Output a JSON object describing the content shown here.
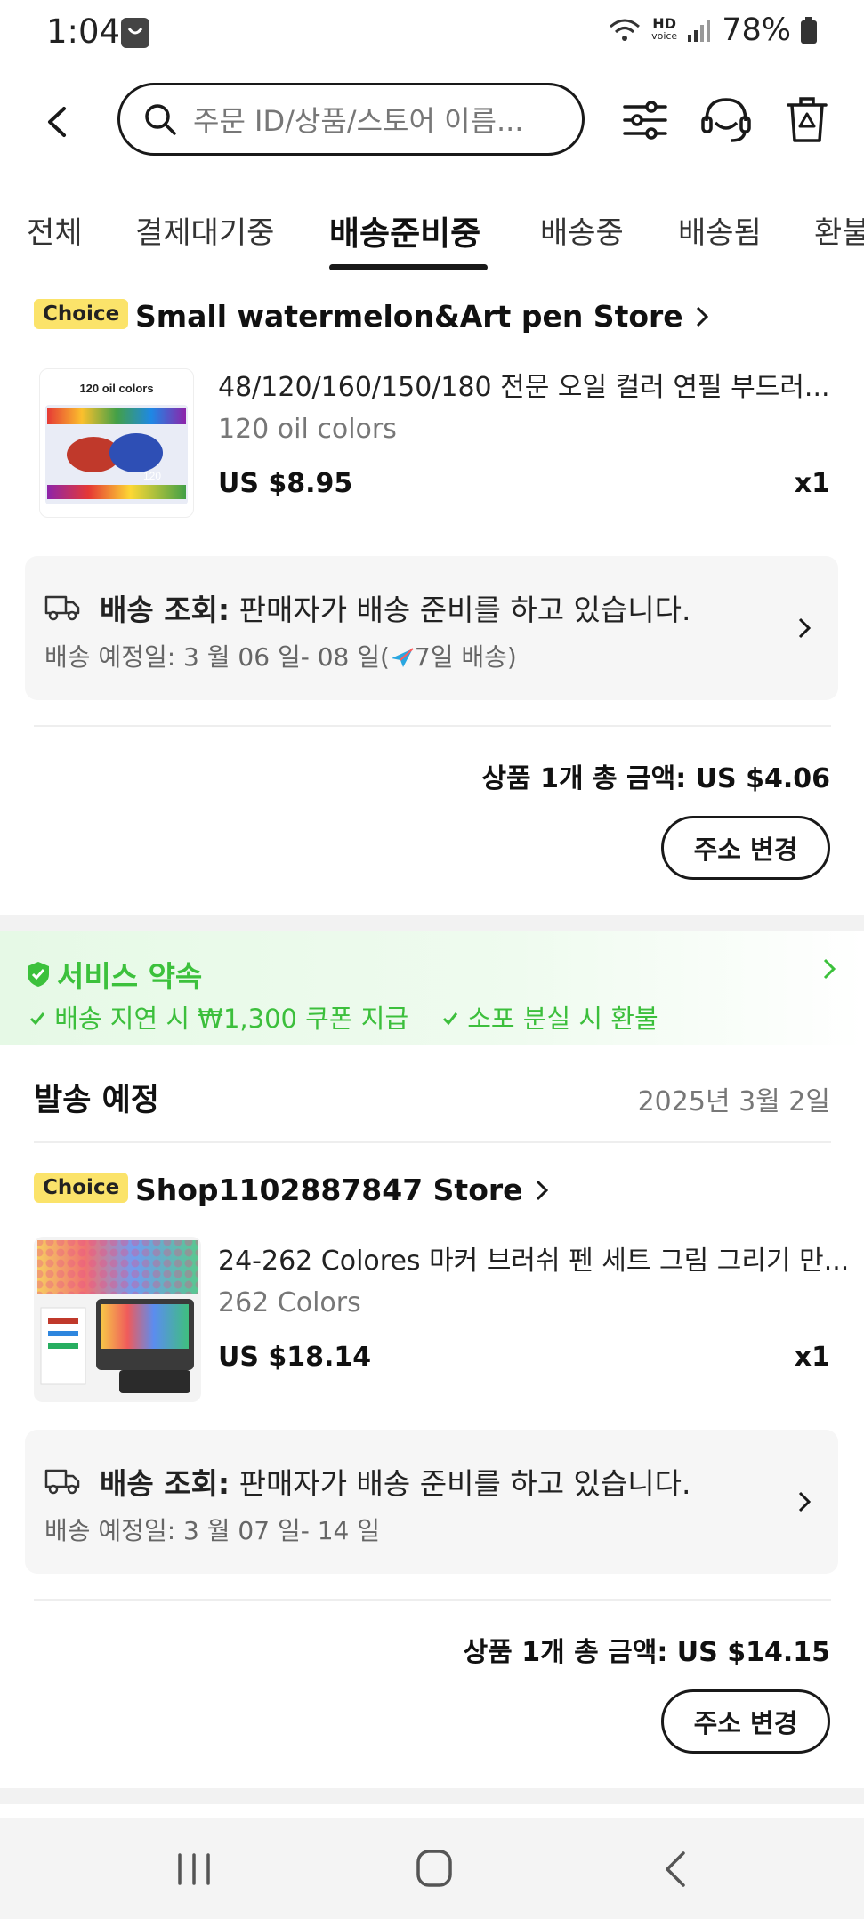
{
  "status": {
    "time": "1:04",
    "hd": "HD",
    "voice": "voice",
    "battery": "78%"
  },
  "search": {
    "placeholder": "주문 ID/상품/스토어 이름..."
  },
  "tabs": [
    "전체",
    "결제대기중",
    "배송준비중",
    "배송중",
    "배송됨",
    "환불"
  ],
  "active_tab": "배송준비중",
  "orders": [
    {
      "badge": "Choice",
      "store": "Small watermelon&Art pen Store",
      "thumb_text": "120 oil colors",
      "thumb_num": "120",
      "title": "48/120/160/150/180 전문 오일 컬러 연필 부드러...",
      "variant": "120 oil colors",
      "price": "US $8.95",
      "qty": "x1",
      "ship_label": "배송 조회:",
      "ship_text": " 판매자가 배송 준비를 하고 있습니다.",
      "ship_eta_prefix": "배송 예정일: 3 월 06 일- 08 일(",
      "ship_eta_suffix": "7일 배송)",
      "total": "상품 1개 총 금액: US $4.06",
      "button": "주소 변경"
    },
    {
      "badge": "Choice",
      "store": "Shop1102887847 Store",
      "title": "24-262 Colores 마커 브러쉬 펜 세트 그림 그리기 만...",
      "variant": "262 Colors",
      "price": "US $18.14",
      "qty": "x1",
      "ship_label": "배송 조회:",
      "ship_text": " 판매자가 배송 준비를 하고 있습니다.",
      "ship_eta": "배송 예정일: 3 월 07 일- 14 일",
      "total": "상품 1개 총 금액: US $14.15",
      "button": "주소 변경"
    }
  ],
  "service": {
    "title": "서비스 약속",
    "items": [
      "배송 지연 시 ₩1,300 쿠폰 지급",
      "소포 분실 시 환불"
    ]
  },
  "schedule": {
    "title": "발송 예정",
    "date": "2025년 3월 2일"
  },
  "colors": {
    "accent_green": "#3cc13c",
    "badge_yellow": "#fbe36a",
    "text": "#191919"
  }
}
